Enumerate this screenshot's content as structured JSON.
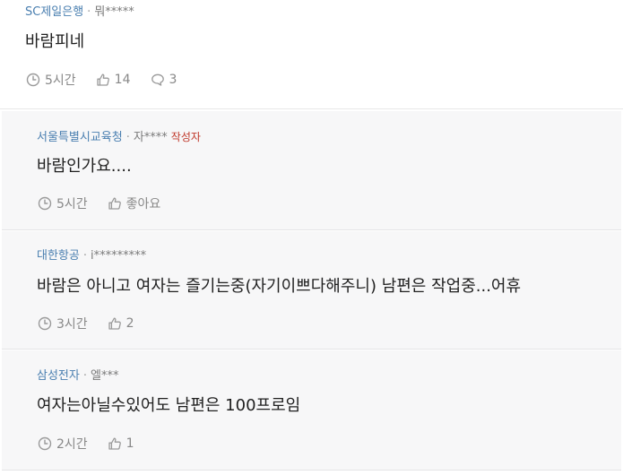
{
  "comments": [
    {
      "company": "SC제일은행",
      "separator": "·",
      "nickname": "뭐*****",
      "author_tag": "",
      "body": "바람피네",
      "time": "5시간",
      "likes": "14",
      "replies": "3"
    },
    {
      "company": "서울특별시교육청",
      "separator": "·",
      "nickname": "자****",
      "author_tag": "작성자",
      "body": "바람인가요....",
      "time": "5시간",
      "likes": "좋아요"
    },
    {
      "company": "대한항공",
      "separator": "·",
      "nickname": "i*********",
      "author_tag": "",
      "body": "바람은 아니고 여자는 즐기는중(자기이쁘다해주니) 남편은 작업중...어휴",
      "time": "3시간",
      "likes": "2"
    },
    {
      "company": "삼성전자",
      "separator": "·",
      "nickname": "엘***",
      "author_tag": "",
      "body": "여자는아닐수있어도 남편은 100프로임",
      "time": "2시간",
      "likes": "1"
    }
  ],
  "icons": {
    "time": "clock-icon",
    "like": "thumbs-up-icon",
    "reply": "speech-bubble-icon"
  },
  "colors": {
    "company": "#4a7fb0",
    "author_tag": "#c0392b",
    "reply_background": "#f7f7f8",
    "meta_gray": "#888888"
  }
}
